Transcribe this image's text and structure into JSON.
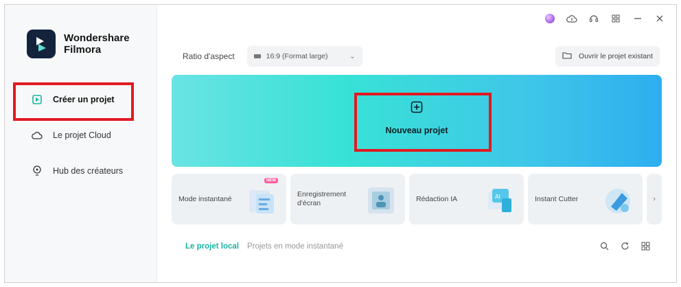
{
  "app": {
    "name_line1": "Wondershare",
    "name_line2": "Filmora"
  },
  "sidebar": {
    "items": [
      {
        "label": "Créer un projet",
        "icon": "new-project-icon"
      },
      {
        "label": "Le projet Cloud",
        "icon": "cloud-icon"
      },
      {
        "label": "Hub des créateurs",
        "icon": "bulb-icon"
      }
    ]
  },
  "toolbar": {
    "ratio_label": "Ratio d'aspect",
    "ratio_value": "16:9 (Format large)",
    "open_existing": "Ouvrir le projet existant"
  },
  "banner": {
    "label": "Nouveau projet"
  },
  "cards": [
    {
      "label": "Mode instantané",
      "badge": "NEW"
    },
    {
      "label": "Enregistrement d'écran"
    },
    {
      "label": "Rédaction IA"
    },
    {
      "label": "Instant Cutter"
    }
  ],
  "tabs": {
    "local": "Le projet local",
    "instant": "Projets en mode instantané"
  },
  "colors": {
    "accent": "#18b5a4",
    "highlight": "#e01a22",
    "banner_start": "#69e3e4",
    "banner_end": "#2eaef0"
  }
}
